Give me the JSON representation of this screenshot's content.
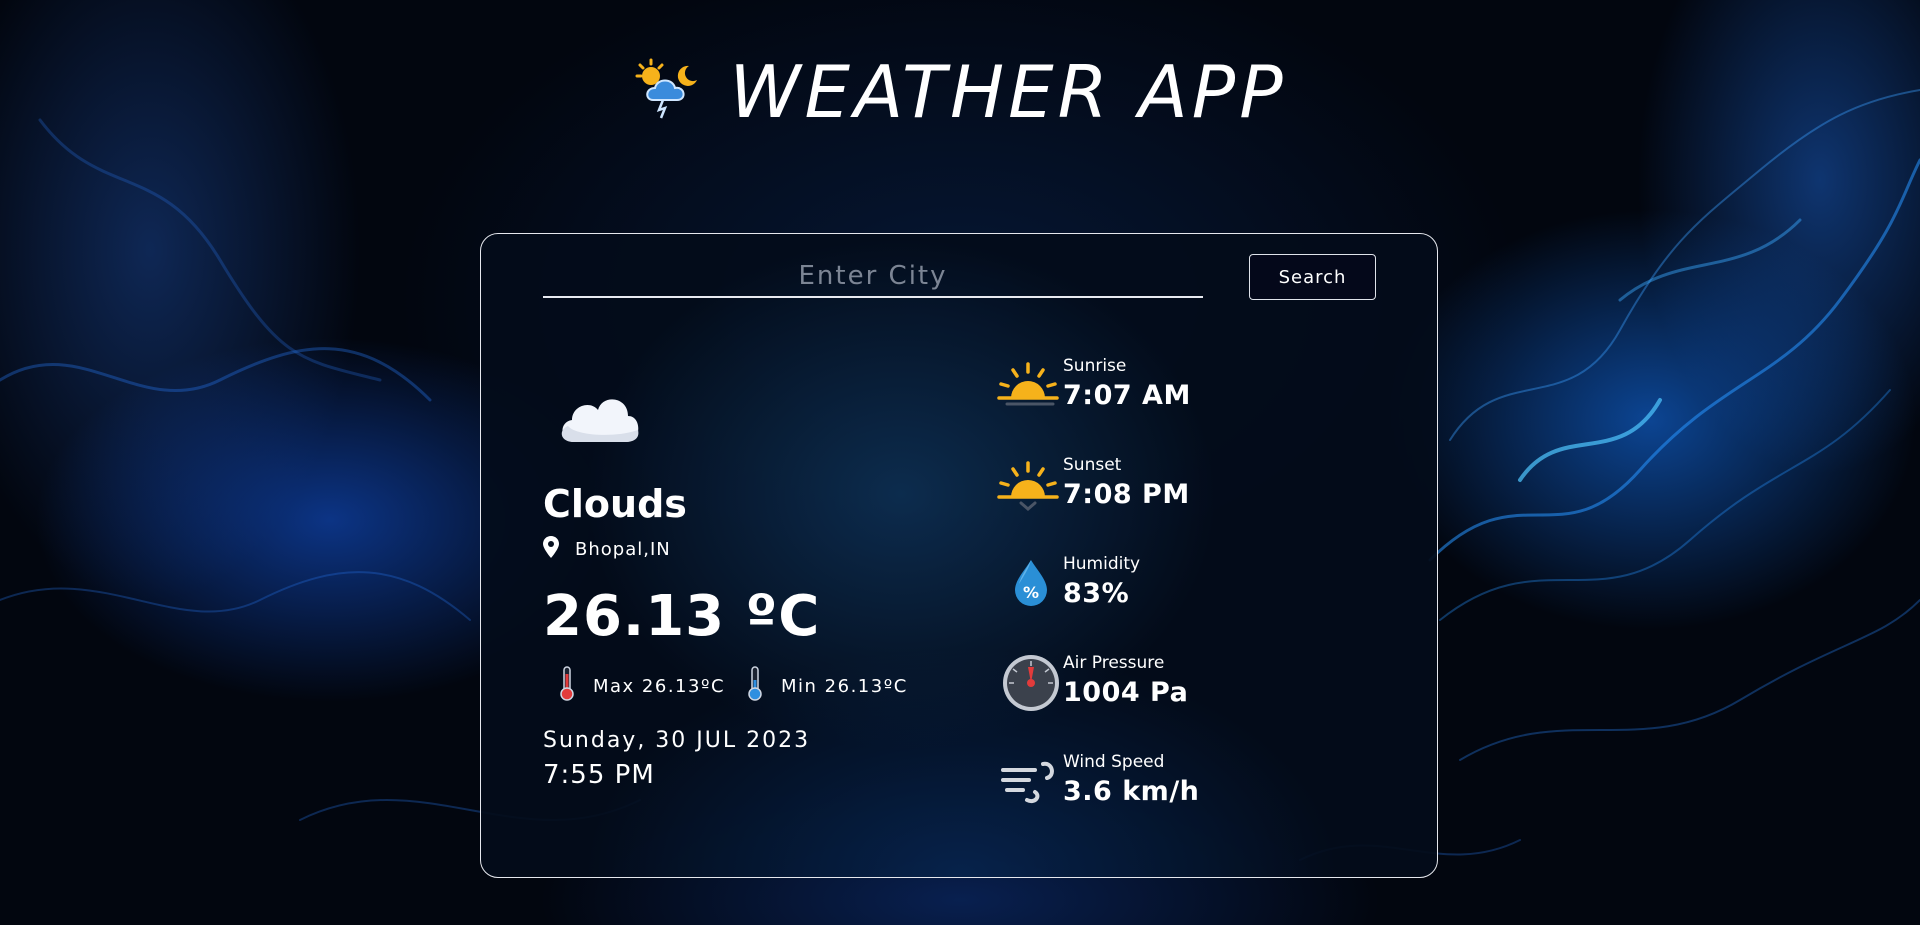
{
  "header": {
    "title": "WEATHER APP"
  },
  "search": {
    "placeholder": "Enter City",
    "button_label": "Search"
  },
  "current": {
    "condition": "Clouds",
    "location": "Bhopal,IN",
    "temperature": "26.13 ºC",
    "max_label": "Max 26.13ºC",
    "min_label": "Min 26.13ºC",
    "date": "Sunday, 30 JUL 2023",
    "time": "7:55 PM"
  },
  "stats": [
    {
      "label": "Sunrise",
      "value": "7:07 AM",
      "icon": "sunrise-icon"
    },
    {
      "label": "Sunset",
      "value": "7:08 PM",
      "icon": "sunset-icon"
    },
    {
      "label": "Humidity",
      "value": "83%",
      "icon": "humidity-icon"
    },
    {
      "label": "Air Pressure",
      "value": "1004 Pa",
      "icon": "pressure-gauge-icon"
    },
    {
      "label": "Wind Speed",
      "value": "3.6 km/h",
      "icon": "wind-icon"
    }
  ],
  "colors": {
    "accent_sun": "#f6b21b",
    "water": "#2a8fd6",
    "card_border": "#e6e8ee"
  }
}
